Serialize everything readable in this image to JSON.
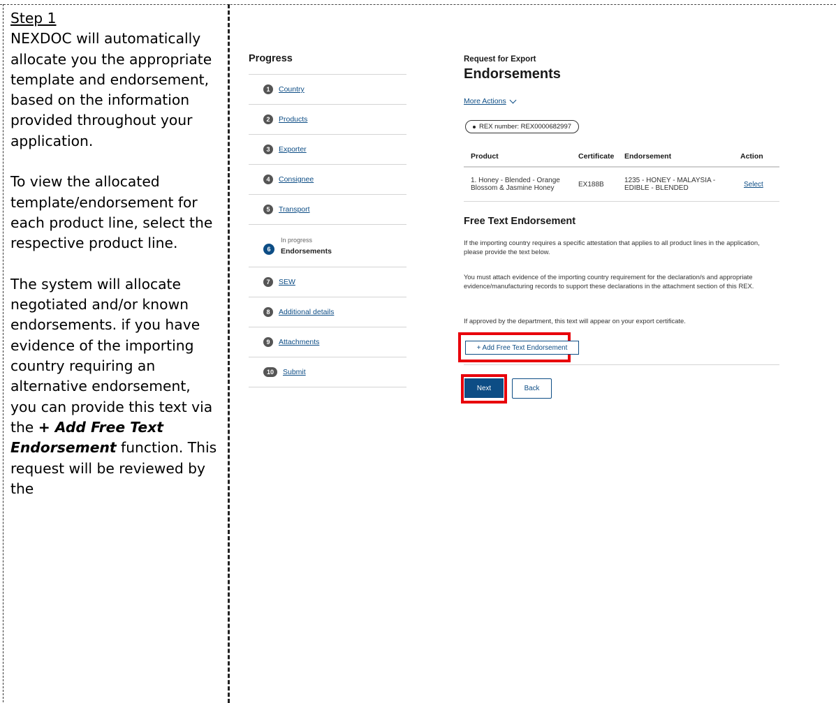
{
  "instructions": {
    "step_title": "Step 1",
    "para1": "NEXDOC will automatically allocate you the appropriate template and endorsement, based on the information provided throughout your application.",
    "para2": "To view the allocated template/endorsement for each product line, select the respective product line.",
    "para3_before": "The system will allocate negotiated and/or known endorsements. if you have evidence of the importing country requiring an alternative endorsement, you can provide this text via the ",
    "para3_emph": "+ Add Free Text Endorsement",
    "para3_after": " function. This request will be reviewed by the"
  },
  "progress": {
    "title": "Progress",
    "steps": [
      {
        "num": "1",
        "label": "Country"
      },
      {
        "num": "2",
        "label": "Products"
      },
      {
        "num": "3",
        "label": "Exporter"
      },
      {
        "num": "4",
        "label": "Consignee"
      },
      {
        "num": "5",
        "label": "Transport"
      },
      {
        "num": "6",
        "status": "In progress",
        "label": "Endorsements"
      },
      {
        "num": "7",
        "label": "SEW"
      },
      {
        "num": "8",
        "label": "Additional details"
      },
      {
        "num": "9",
        "label": "Attachments"
      },
      {
        "num": "10",
        "label": "Submit"
      }
    ],
    "active_step": 6
  },
  "main": {
    "supertitle": "Request for Export",
    "title": "Endorsements",
    "more_actions": "More Actions",
    "rex_pill": "REX number: REX0000682997",
    "table": {
      "headers": [
        "Product",
        "Certificate",
        "Endorsement",
        "Action"
      ],
      "rows": [
        {
          "product": "1. Honey - Blended - Orange Blossom & Jasmine Honey",
          "certificate": "EX188B",
          "endorsement": "1235 - HONEY - MALAYSIA - EDIBLE - BLENDED",
          "action": "Select"
        }
      ]
    },
    "free_text": {
      "title": "Free Text Endorsement",
      "para1": "If the importing country requires a specific attestation that applies to all product lines in the application, please provide the text below.",
      "para2": "You must attach evidence of the importing country requirement for the declaration/s and appropriate evidence/manufacturing records to support these declarations in the attachment section of this REX.",
      "para3": "If approved by the department, this text will appear on your export certificate.",
      "add_button": "+ Add Free Text Endorsement"
    },
    "buttons": {
      "next": "Next",
      "back": "Back"
    }
  },
  "colors": {
    "link_blue": "#0d4d85",
    "highlight_red": "#e8000b",
    "step_gray": "#555555"
  }
}
